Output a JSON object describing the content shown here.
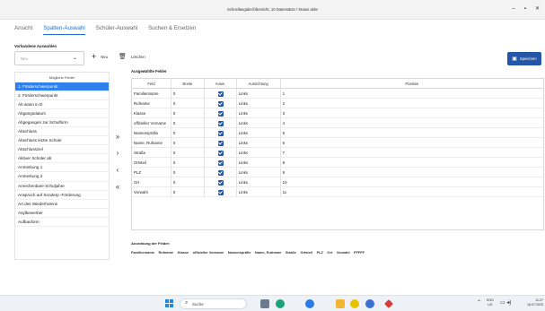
{
  "window": {
    "title": "Schnellangabe/Übersicht, 10 Datensätze / Status aktiv",
    "minimize": "–",
    "maximize": "▪",
    "close": "✕"
  },
  "tabs": [
    {
      "label": "Ansicht",
      "active": false
    },
    {
      "label": "Spalten-Auswahl",
      "active": true
    },
    {
      "label": "Schüler-Auswahl",
      "active": false
    },
    {
      "label": "Suchen & Ersetzen",
      "active": false
    }
  ],
  "toolbar": {
    "section_label": "Vorhandene Auswahlen",
    "select_value": "Neu",
    "select_icon": "chevron-down-icon",
    "new_label": "Neu",
    "delete_label": "Löschen",
    "save_label": "Speichern",
    "save_color": "#2456a8"
  },
  "available_fields": {
    "header": "Mögliche Felder",
    "selected_color": "#2f80ed",
    "items": [
      "1. Förderschwerpunkt",
      "2. Förderschwerpunkt",
      "Ab wann in D.",
      "Abgangsdatum",
      "Abgegangen zur Schulform",
      "Abschluss",
      "Abschluss letzte Schule",
      "Abschlussziel",
      "Aktiver Schüler ab",
      "Anmerkung 1",
      "Anmerkung 2",
      "Anrechenbare Schuljahre",
      "Anspruch auf Sonderp.-Förderung",
      "Art des Wiederholens",
      "Asylbewerber",
      "Aufbauform"
    ]
  },
  "move_buttons": {
    "add_all": "»",
    "add": "›",
    "remove": "‹",
    "remove_all": "«"
  },
  "selected_fields": {
    "label": "Ausgewählte Felder",
    "columns": [
      "Feld",
      "Breite",
      "Ausw.",
      "Ausrichtung",
      "Position"
    ],
    "rows": [
      {
        "feld": "Familienname",
        "breite": "0",
        "ausw": true,
        "ausrichtung": "Links",
        "position": "1"
      },
      {
        "feld": "Rufname",
        "breite": "0",
        "ausw": true,
        "ausrichtung": "Links",
        "position": "2"
      },
      {
        "feld": "Klasse",
        "breite": "0",
        "ausw": true,
        "ausrichtung": "Links",
        "position": "3"
      },
      {
        "feld": "offizieller Vorname",
        "breite": "0",
        "ausw": true,
        "ausrichtung": "Links",
        "position": "4"
      },
      {
        "feld": "Namenspräfix",
        "breite": "0",
        "ausw": true,
        "ausrichtung": "Links",
        "position": "5"
      },
      {
        "feld": "Name, Rufname",
        "breite": "0",
        "ausw": true,
        "ausrichtung": "Links",
        "position": "6"
      },
      {
        "feld": "Straße",
        "breite": "0",
        "ausw": true,
        "ausrichtung": "Links",
        "position": "7"
      },
      {
        "feld": "Ortsteil",
        "breite": "0",
        "ausw": true,
        "ausrichtung": "Links",
        "position": "8"
      },
      {
        "feld": "PLZ",
        "breite": "0",
        "ausw": true,
        "ausrichtung": "Links",
        "position": "9"
      },
      {
        "feld": "Ort",
        "breite": "0",
        "ausw": true,
        "ausrichtung": "Links",
        "position": "10"
      },
      {
        "feld": "Vorwahl",
        "breite": "0",
        "ausw": true,
        "ausrichtung": "Links",
        "position": "11"
      }
    ]
  },
  "field_order": {
    "label": "Anordnung der Felder:",
    "items": [
      "Familienname",
      "Rufname",
      "Klasse",
      "offizieller Vorname",
      "Namenspräfix",
      "Name, Rufname",
      "Straße",
      "Ortsteil",
      "PLZ",
      "Ort",
      "Vorwahl",
      "FFFFF"
    ]
  },
  "taskbar": {
    "search_label": "Suche",
    "language": "ENG",
    "layout": "US",
    "time": "11:27",
    "date": "18.07.2025",
    "start_color": "#1e88e5"
  }
}
